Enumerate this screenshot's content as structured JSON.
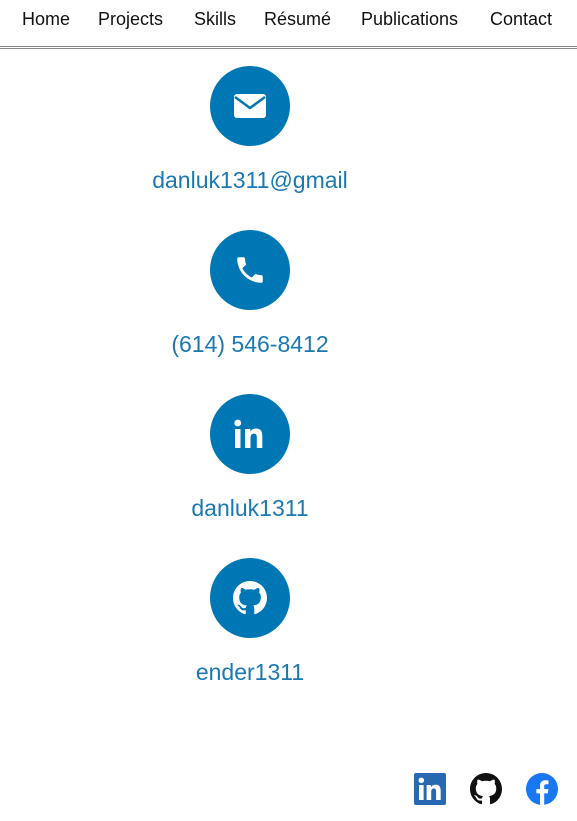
{
  "nav": {
    "items": [
      {
        "label": "Home"
      },
      {
        "label": "Projects"
      },
      {
        "label": "Skills"
      },
      {
        "label": "Résumé"
      },
      {
        "label": "Publications"
      },
      {
        "label": "Contact"
      }
    ]
  },
  "contact": {
    "items": [
      {
        "icon": "envelope-icon",
        "text": "danluk1311@gmail"
      },
      {
        "icon": "phone-icon",
        "text": "(614) 546-8412"
      },
      {
        "icon": "linkedin-icon",
        "text": "danluk1311"
      },
      {
        "icon": "github-icon",
        "text": "ender1311"
      }
    ]
  },
  "footer": {
    "social": [
      {
        "icon": "linkedin-icon",
        "color": "#2867b2"
      },
      {
        "icon": "github-icon",
        "color": "#111111"
      },
      {
        "icon": "facebook-icon",
        "color": "#1877f2"
      }
    ]
  },
  "colors": {
    "accent": "#0077b5",
    "link": "#1a78b4"
  }
}
